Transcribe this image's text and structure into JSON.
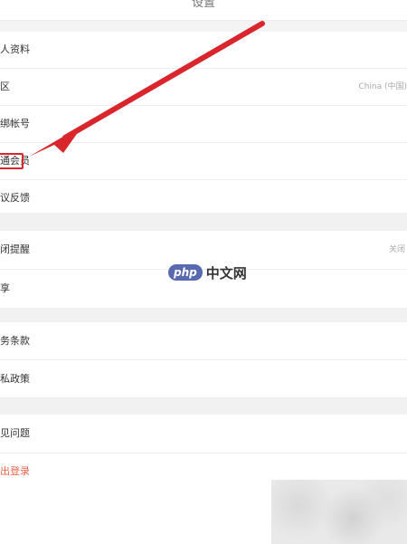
{
  "header": {
    "title": "设置"
  },
  "section1": {
    "items": [
      {
        "label": "人资料"
      },
      {
        "label": "区",
        "value": "China (中国)"
      },
      {
        "label": "绑帐号"
      },
      {
        "label": "通会员"
      },
      {
        "label": "议反馈"
      }
    ]
  },
  "gap1": {
    "text": ""
  },
  "section2": {
    "items": [
      {
        "label": "闭提醒",
        "value": "关闭"
      },
      {
        "label": "享"
      }
    ]
  },
  "gap2": {
    "text": ""
  },
  "section3": {
    "items": [
      {
        "label": "务条款"
      },
      {
        "label": "私政策"
      }
    ]
  },
  "gap3": {
    "text": ""
  },
  "section4": {
    "items": [
      {
        "label": "见问题"
      },
      {
        "label": "出登录"
      }
    ]
  },
  "watermark": {
    "badge": "php",
    "text": "中文网"
  },
  "colors": {
    "arrow": "#d8262c",
    "logout": "#e8644a",
    "page_bg": "#f4f4f4"
  }
}
